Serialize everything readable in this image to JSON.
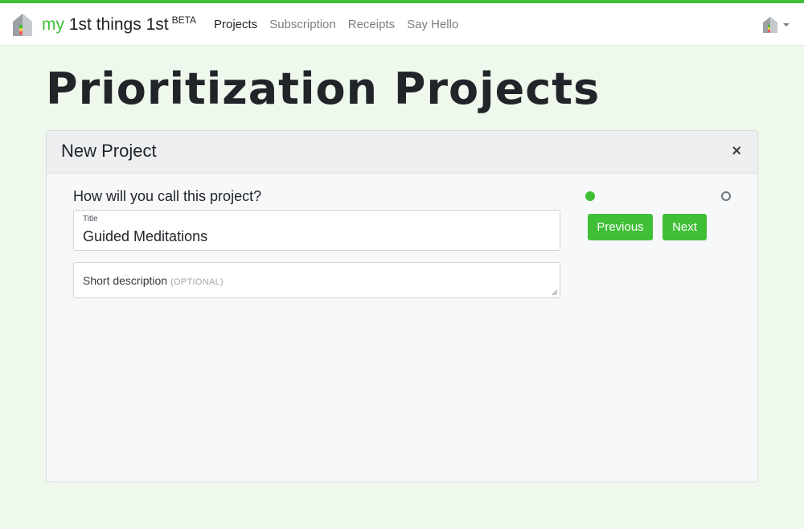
{
  "brand": {
    "prefix": "my",
    "name": "1st things 1st",
    "badge": "BETA"
  },
  "nav": {
    "items": [
      {
        "label": "Projects",
        "active": true
      },
      {
        "label": "Subscription",
        "active": false
      },
      {
        "label": "Receipts",
        "active": false
      },
      {
        "label": "Say Hello",
        "active": false
      }
    ]
  },
  "page": {
    "title": "Prioritization Projects"
  },
  "card": {
    "title": "New Project",
    "close_symbol": "×",
    "question": "How will you call this project?",
    "title_field": {
      "label": "Title",
      "value": "Guided Meditations"
    },
    "description_field": {
      "placeholder": "Short description",
      "optional_tag": "(OPTIONAL)"
    },
    "buttons": {
      "previous": "Previous",
      "next": "Next"
    }
  },
  "colors": {
    "accent": "#3fbf35",
    "background": "#eef8ec"
  },
  "icons": [
    "house-logo-icon",
    "user-avatar-icon",
    "caret-down-icon",
    "close-icon"
  ]
}
